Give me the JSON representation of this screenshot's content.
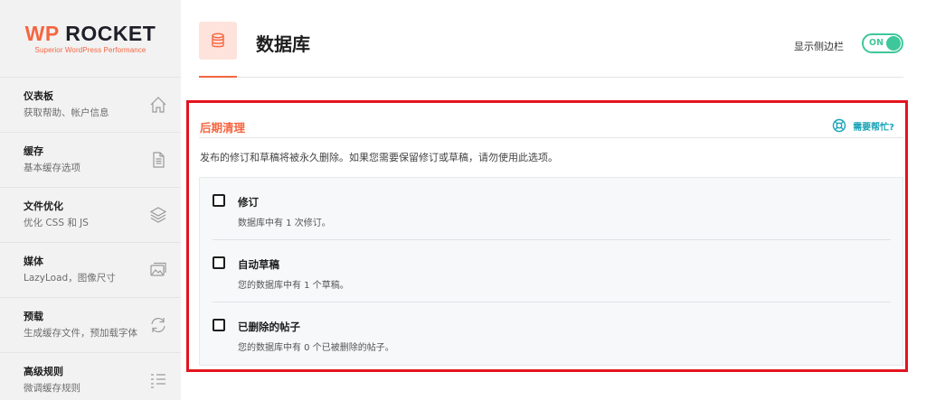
{
  "brand": {
    "logo_text_wp": "WP",
    "logo_text_rocket": "ROCKET",
    "tagline": "Superior WordPress Performance"
  },
  "sidebar": {
    "items": [
      {
        "title": "仪表板",
        "desc": "获取帮助、帐户信息",
        "icon": "home-icon"
      },
      {
        "title": "缓存",
        "desc": "基本缓存选项",
        "icon": "document-icon"
      },
      {
        "title": "文件优化",
        "desc": "优化 CSS 和 JS",
        "icon": "layers-icon"
      },
      {
        "title": "媒体",
        "desc": "LazyLoad，图像尺寸",
        "icon": "images-icon"
      },
      {
        "title": "预载",
        "desc": "生成缓存文件，预加载字体",
        "icon": "refresh-icon"
      },
      {
        "title": "高级规则",
        "desc": "微调缓存规则",
        "icon": "list-icon"
      }
    ]
  },
  "header": {
    "title": "数据库",
    "icon": "database-icon",
    "sidebar_toggle_label": "显示侧边栏",
    "toggle_text": "ON",
    "toggle_on": true
  },
  "section": {
    "title": "后期清理",
    "help_label": "需要帮忙?",
    "description": "发布的修订和草稿将被永久删除。如果您需要保留修订或草稿，请勿使用此选项。",
    "options": [
      {
        "label": "修订",
        "desc": "数据库中有 1 次修订。",
        "checked": false
      },
      {
        "label": "自动草稿",
        "desc": "您的数据库中有 1 个草稿。",
        "checked": false
      },
      {
        "label": "已删除的帖子",
        "desc": "您的数据库中有 0 个已被删除的帖子。",
        "checked": false
      }
    ]
  },
  "colors": {
    "accent": "#f56640",
    "toggle": "#3ec79a",
    "help": "#1ba4b7",
    "highlight_border": "#e3141e"
  }
}
